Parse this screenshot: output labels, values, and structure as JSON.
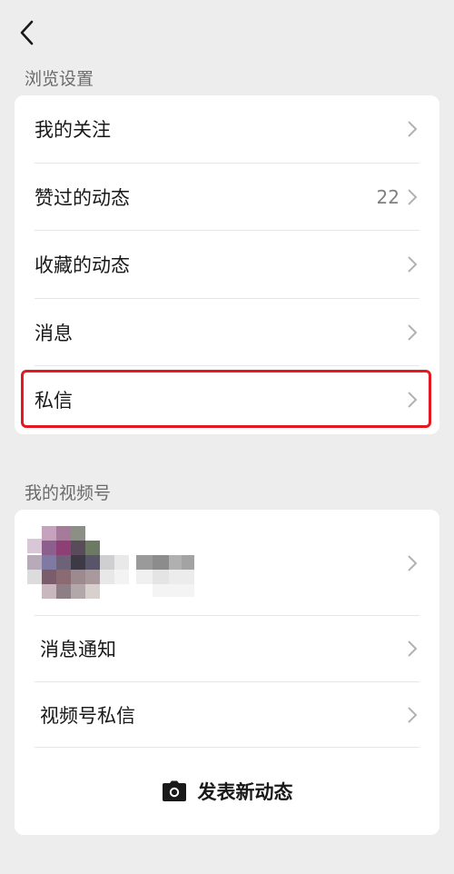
{
  "header": {
    "back_icon": "chevron-left-icon"
  },
  "browse_section": {
    "title": "浏览设置",
    "items": [
      {
        "label": "我的关注",
        "count": ""
      },
      {
        "label": "赞过的动态",
        "count": "22"
      },
      {
        "label": "收藏的动态",
        "count": ""
      },
      {
        "label": "消息",
        "count": ""
      },
      {
        "label": "私信",
        "count": ""
      }
    ]
  },
  "channels_section": {
    "title": "我的视频号",
    "items": [
      {
        "label": "消息通知"
      },
      {
        "label": "视频号私信"
      }
    ],
    "post_label": "发表新动态",
    "post_icon": "camera-icon"
  },
  "colors": {
    "highlight": "#e3191f",
    "background": "#ededed",
    "card": "#ffffff"
  }
}
